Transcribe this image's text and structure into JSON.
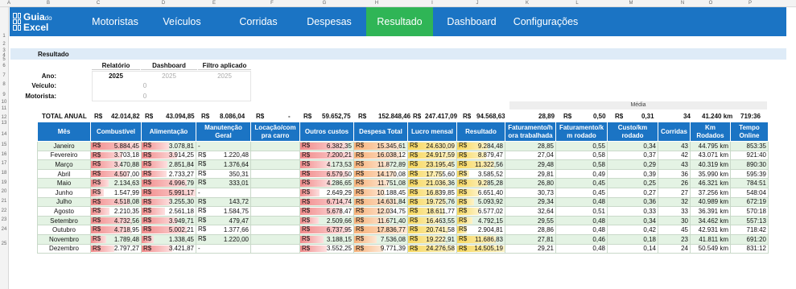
{
  "columns": [
    "A",
    "B",
    "C",
    "D",
    "E",
    "F",
    "G",
    "H",
    "I",
    "J",
    "K",
    "L",
    "M",
    "N",
    "O",
    "P"
  ],
  "rows": [
    "1",
    "2",
    "3",
    "4",
    "5",
    "6",
    "7",
    "8",
    "9",
    "10",
    "11",
    "12",
    "13",
    "14",
    "15",
    "16",
    "17",
    "18",
    "19",
    "20",
    "21",
    "22",
    "23",
    "24",
    "25"
  ],
  "logo": {
    "word1": "Guia",
    "word1b": "do",
    "word2": "Excel"
  },
  "nav": [
    "Motoristas",
    "Veículos",
    "Corridas",
    "Despesas",
    "Resultado",
    "Dashboard",
    "Configurações"
  ],
  "section_title": "Resultado",
  "filter": {
    "headers": [
      "Relatório",
      "Dashboard",
      "Filtro aplicado"
    ],
    "labels": [
      "Ano:",
      "Veículo:",
      "Motorista:"
    ],
    "ano": "2025",
    "dash_ano": "2025",
    "filtro_ano": "2025",
    "veiculo_dash": "0",
    "motorista_dash": "0"
  },
  "media_label": "Média",
  "totals": {
    "label": "TOTAL ANUAL",
    "cur": "R$",
    "combustivel": "42.014,82",
    "alimentacao": "43.094,85",
    "manutencao": "8.086,04",
    "locacao": "-",
    "outros": "59.652,75",
    "despesa": "152.848,46",
    "lucro": "247.417,09",
    "resultado": "94.568,63",
    "fat_h": "28,89",
    "fat_km": "0,50",
    "custo_km": "0,31",
    "corridas": "34",
    "km": "41.240 km",
    "tempo": "719:36"
  },
  "table": {
    "headers": [
      "Mês",
      "Combustível",
      "Alimentação",
      "Manutenção Geral",
      "Locação/com pra carro",
      "Outros custos",
      "Despesa Total",
      "Lucro mensal",
      "Resultado",
      "Faturamento/h ora trabalhada",
      "Faturamento/k m rodado",
      "Custo/km rodado",
      "Corridas",
      "Km Rodados",
      "Tempo Online"
    ],
    "rows": [
      {
        "mes": "Janeiro",
        "comb": "5.884,45",
        "alim": "3.078,81",
        "manut": "-",
        "loc": "",
        "outros": "6.382,35",
        "desp": "15.345,61",
        "lucro": "24.630,09",
        "res": "9.284,48",
        "fh": "28,85",
        "fkm": "0,55",
        "ckm": "0,34",
        "corr": "43",
        "km": "44.795 km",
        "tempo": "853:35"
      },
      {
        "mes": "Fevereiro",
        "comb": "3.703,18",
        "alim": "3.914,25",
        "manut": "1.220,48",
        "loc": "",
        "outros": "7.200,21",
        "desp": "16.038,12",
        "lucro": "24.917,59",
        "res": "8.879,47",
        "fh": "27,04",
        "fkm": "0,58",
        "ckm": "0,37",
        "corr": "42",
        "km": "43.071 km",
        "tempo": "921:40"
      },
      {
        "mes": "Março",
        "comb": "3.470,88",
        "alim": "2.851,84",
        "manut": "1.376,64",
        "loc": "",
        "outros": "4.173,53",
        "desp": "11.872,89",
        "lucro": "23.195,45",
        "res": "11.322,56",
        "fh": "29,48",
        "fkm": "0,58",
        "ckm": "0,29",
        "corr": "43",
        "km": "40.319 km",
        "tempo": "890:30"
      },
      {
        "mes": "Abril",
        "comb": "4.507,00",
        "alim": "2.733,27",
        "manut": "350,31",
        "loc": "",
        "outros": "6.579,50",
        "desp": "14.170,08",
        "lucro": "17.755,60",
        "res": "3.585,52",
        "fh": "29,81",
        "fkm": "0,49",
        "ckm": "0,39",
        "corr": "36",
        "km": "35.990 km",
        "tempo": "595:39"
      },
      {
        "mes": "Maio",
        "comb": "2.134,63",
        "alim": "4.996,79",
        "manut": "333,01",
        "loc": "",
        "outros": "4.286,65",
        "desp": "11.751,08",
        "lucro": "21.036,36",
        "res": "9.285,28",
        "fh": "26,80",
        "fkm": "0,45",
        "ckm": "0,25",
        "corr": "26",
        "km": "46.321 km",
        "tempo": "784:51"
      },
      {
        "mes": "Junho",
        "comb": "1.547,99",
        "alim": "5.991,17",
        "manut": "-",
        "loc": "",
        "outros": "2.649,29",
        "desp": "10.188,45",
        "lucro": "16.839,85",
        "res": "6.651,40",
        "fh": "30,73",
        "fkm": "0,45",
        "ckm": "0,27",
        "corr": "27",
        "km": "37.256 km",
        "tempo": "548:04"
      },
      {
        "mes": "Julho",
        "comb": "4.518,08",
        "alim": "3.255,30",
        "manut": "143,72",
        "loc": "",
        "outros": "6.714,74",
        "desp": "14.631,84",
        "lucro": "19.725,76",
        "res": "5.093,92",
        "fh": "29,34",
        "fkm": "0,48",
        "ckm": "0,36",
        "corr": "32",
        "km": "40.989 km",
        "tempo": "672:19"
      },
      {
        "mes": "Agosto",
        "comb": "2.210,35",
        "alim": "2.561,18",
        "manut": "1.584,75",
        "loc": "",
        "outros": "5.678,47",
        "desp": "12.034,75",
        "lucro": "18.611,77",
        "res": "6.577,02",
        "fh": "32,64",
        "fkm": "0,51",
        "ckm": "0,33",
        "corr": "33",
        "km": "36.391 km",
        "tempo": "570:18"
      },
      {
        "mes": "Setembro",
        "comb": "4.732,56",
        "alim": "3.949,71",
        "manut": "479,47",
        "loc": "",
        "outros": "2.509,66",
        "desp": "11.671,40",
        "lucro": "16.463,55",
        "res": "4.792,15",
        "fh": "29,55",
        "fkm": "0,48",
        "ckm": "0,34",
        "corr": "30",
        "km": "34.462 km",
        "tempo": "557:13"
      },
      {
        "mes": "Outubro",
        "comb": "4.718,95",
        "alim": "5.002,21",
        "manut": "1.377,66",
        "loc": "",
        "outros": "6.737,95",
        "desp": "17.836,77",
        "lucro": "20.741,58",
        "res": "2.904,81",
        "fh": "28,86",
        "fkm": "0,48",
        "ckm": "0,42",
        "corr": "45",
        "km": "42.931 km",
        "tempo": "718:42"
      },
      {
        "mes": "Novembro",
        "comb": "1.789,48",
        "alim": "1.338,45",
        "manut": "1.220,00",
        "loc": "",
        "outros": "3.188,15",
        "desp": "7.536,08",
        "lucro": "19.222,91",
        "res": "11.686,83",
        "fh": "27,81",
        "fkm": "0,46",
        "ckm": "0,18",
        "corr": "23",
        "km": "41.811 km",
        "tempo": "691:20"
      },
      {
        "mes": "Dezembro",
        "comb": "2.797,27",
        "alim": "3.421,87",
        "manut": "-",
        "loc": "",
        "outros": "3.552,25",
        "desp": "9.771,39",
        "lucro": "24.276,58",
        "res": "14.505,19",
        "fh": "29,21",
        "fkm": "0,48",
        "ckm": "0,14",
        "corr": "24",
        "km": "50.549 km",
        "tempo": "831:12"
      }
    ]
  },
  "colors": {
    "nav": "#1b74c4",
    "active_tab": "#2fb556",
    "section": "#deebf7",
    "row_alt": "#e4f3e4"
  },
  "icons": {
    "logo": "grid-logo-icon"
  }
}
